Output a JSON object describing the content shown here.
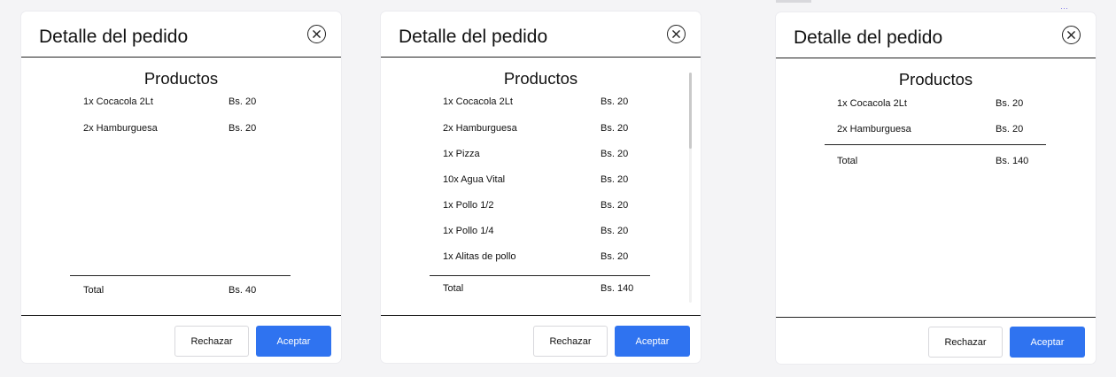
{
  "modals": [
    {
      "title": "Detalle del pedido",
      "section_title": "Productos",
      "items": [
        {
          "name": "1x Cocacola 2Lt",
          "price": "Bs. 20"
        },
        {
          "name": "2x Hamburguesa",
          "price": "Bs. 20"
        }
      ],
      "total_label": "Total",
      "total_value": "Bs. 40",
      "reject_label": "Rechazar",
      "accept_label": "Aceptar"
    },
    {
      "title": "Detalle del pedido",
      "section_title": "Productos",
      "items": [
        {
          "name": "1x Cocacola 2Lt",
          "price": "Bs. 20"
        },
        {
          "name": "2x Hamburguesa",
          "price": "Bs. 20"
        },
        {
          "name": "1x Pizza",
          "price": "Bs. 20"
        },
        {
          "name": "10x Agua Vital",
          "price": "Bs. 20"
        },
        {
          "name": "1x Pollo 1/2",
          "price": "Bs. 20"
        },
        {
          "name": "1x Pollo 1/4",
          "price": "Bs. 20"
        },
        {
          "name": "1x Alitas de pollo",
          "price": "Bs. 20"
        }
      ],
      "total_label": "Total",
      "total_value": "Bs. 140",
      "reject_label": "Rechazar",
      "accept_label": "Aceptar"
    },
    {
      "title": "Detalle del pedido",
      "section_title": "Productos",
      "items": [
        {
          "name": "1x Cocacola 2Lt",
          "price": "Bs. 20"
        },
        {
          "name": "2x Hamburguesa",
          "price": "Bs. 20"
        }
      ],
      "total_label": "Total",
      "total_value": "Bs. 140",
      "reject_label": "Rechazar",
      "accept_label": "Aceptar"
    }
  ],
  "colors": {
    "accent": "#2f73f0",
    "background": "#f4f4f6",
    "card": "#ffffff",
    "text": "#111111"
  },
  "icons": {
    "close": "close-icon"
  }
}
